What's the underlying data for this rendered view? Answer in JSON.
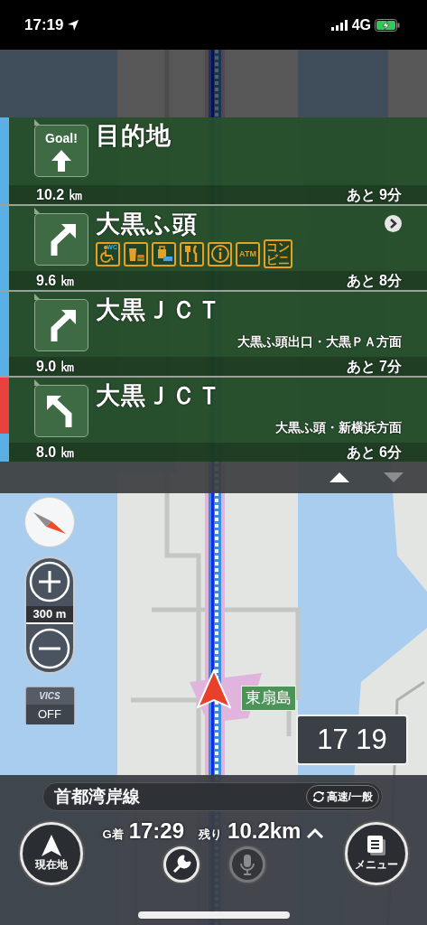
{
  "status_bar": {
    "time": "17:19",
    "network": "4G"
  },
  "guidance": [
    {
      "kind": "goal",
      "sign_label": "Goal!",
      "name": "目的地",
      "distance": "10.2 ㎞",
      "remaining": "あと 9分",
      "details": false,
      "strip": [
        {
          "color": "#5aafe6"
        }
      ]
    },
    {
      "kind": "bear_right",
      "name": "大黒ふ頭",
      "facilities": [
        {
          "kind": "toilet",
          "label": "WC"
        },
        {
          "kind": "fastfood"
        },
        {
          "kind": "shop"
        },
        {
          "kind": "restaurant"
        },
        {
          "kind": "info"
        },
        {
          "kind": "atm",
          "label": "ATM"
        },
        {
          "kind": "convenience",
          "label": "コンビニ"
        }
      ],
      "distance": "9.6 ㎞",
      "remaining": "あと 8分",
      "details": true,
      "strip": [
        {
          "color": "#5aafe6"
        }
      ]
    },
    {
      "kind": "bear_right",
      "name": "大黒ＪＣＴ",
      "direction": "大黒ふ頭出口・大黒ＰＡ方面",
      "distance": "9.0 ㎞",
      "remaining": "あと 7分",
      "details": false,
      "strip": [
        {
          "color": "#5aafe6"
        }
      ]
    },
    {
      "kind": "bear_left",
      "name": "大黒ＪＣＴ",
      "direction": "大黒ふ頭・新横浜方面",
      "distance": "8.0 ㎞",
      "remaining": "あと 6分",
      "details": false,
      "strip": [
        {
          "color": "#e8423f"
        },
        {
          "color": "#e8423f"
        },
        {
          "color": "#5aafe6"
        }
      ]
    }
  ],
  "pager": [
    {
      "kind": "up",
      "disabled": false
    },
    {
      "kind": "down",
      "disabled": true
    }
  ],
  "map": {
    "scale": "300 m",
    "vics": {
      "label": "VICS",
      "state": "OFF"
    },
    "place_label": "東扇島",
    "clock": "17 19"
  },
  "bottom": {
    "road": "首都湾岸線",
    "toggle": "高速/一般",
    "arrival_label": "G着",
    "arrival": "17:29",
    "remaining_label": "残り",
    "remaining": "10.2km",
    "buttons": [
      {
        "kind": "location",
        "label": "現在地"
      },
      {
        "kind": "settings",
        "disabled": false
      },
      {
        "kind": "voice",
        "disabled": true
      },
      {
        "kind": "menu",
        "label": "メニュー"
      }
    ]
  }
}
